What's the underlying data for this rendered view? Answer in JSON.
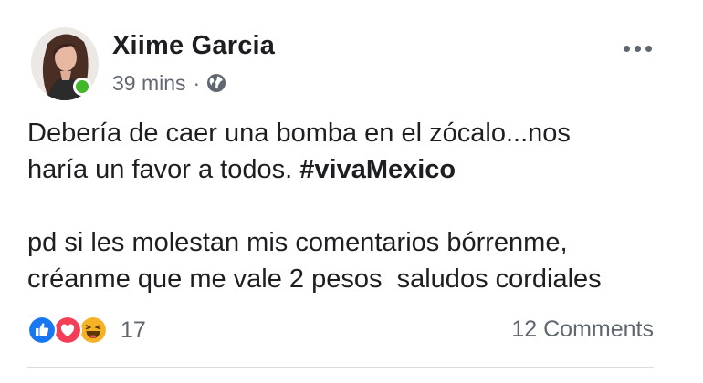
{
  "post": {
    "author": "Xiime Garcia",
    "time": "39 mins",
    "separator": "·",
    "privacy_icon": "globe-icon",
    "more_icon": "more-options-icon",
    "online": true,
    "text": {
      "line1": "Debería de caer una bomba en el zócalo...nos",
      "line2_prefix": "haría un favor a todos. ",
      "hashtag": "#vivaMexico",
      "line3": "pd si les molestan mis comentarios bórrenme,",
      "line4": "créanme que me vale 2 pesos  saludos cordiales"
    },
    "reactions": {
      "icons": [
        "like-reaction-icon",
        "love-reaction-icon",
        "haha-reaction-icon"
      ],
      "count": "17"
    },
    "comments_label": "12 Comments"
  },
  "colors": {
    "text_primary": "#1c1e21",
    "text_secondary": "#606770",
    "online_green": "#42b72a",
    "like_blue": "#1877f2",
    "love_red": "#f33e58",
    "haha_yellow": "#f7b125",
    "divider": "#dadde1"
  }
}
